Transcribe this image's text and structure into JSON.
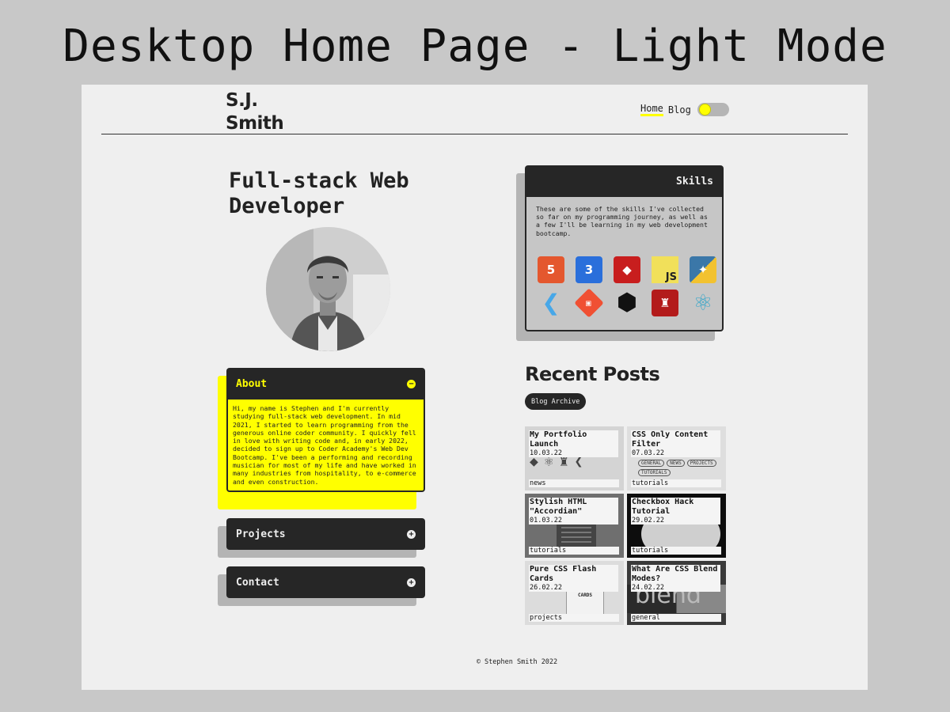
{
  "banner": "Desktop Home Page - Light Mode",
  "header": {
    "logo_line1": "S.J.",
    "logo_line2": "Smith",
    "nav": [
      "Home",
      "Blog"
    ],
    "theme_toggle": "light"
  },
  "hero": {
    "headline": "Full-stack Web Developer"
  },
  "accordion": [
    {
      "label": "About",
      "state": "open",
      "body": "Hi, my name is Stephen and I'm currently studying full-stack web development. In mid 2021, I started to learn programming from the generous online coder community. I quickly fell in love with writing code and, in early 2022, decided to sign up to Coder Academy's Web Dev Bootcamp. I've been a performing and recording musician for most of my life and have worked in many industries from hospitality, to e-commerce and even construction."
    },
    {
      "label": "Projects",
      "state": "closed"
    },
    {
      "label": "Contact",
      "state": "closed"
    }
  ],
  "skills": {
    "title": "Skills",
    "description": "These are some of the skills I've collected so far on my programming journey, as well as a few I'll be learning in my web development bootcamp.",
    "icons": [
      {
        "name": "html5-icon",
        "glyph": "5",
        "color": "#e4572e"
      },
      {
        "name": "css3-icon",
        "glyph": "3",
        "color": "#2a6fdb"
      },
      {
        "name": "ruby-icon",
        "glyph": "◆",
        "color": "#c81e1e"
      },
      {
        "name": "javascript-icon",
        "glyph": "JS",
        "color": "#f1e05a"
      },
      {
        "name": "python-icon",
        "glyph": "✦",
        "color": "#3b77a8"
      },
      {
        "name": "flutter-icon",
        "glyph": "❮",
        "color": "#47a7e8"
      },
      {
        "name": "git-icon",
        "glyph": "◈",
        "color": "#f05033"
      },
      {
        "name": "cube-icon",
        "glyph": "⬢",
        "color": "#222222"
      },
      {
        "name": "rails-icon",
        "glyph": "♜",
        "color": "#b31b1b"
      },
      {
        "name": "react-icon",
        "glyph": "⚛",
        "color": "#61dafb"
      }
    ]
  },
  "recent_posts": {
    "title": "Recent Posts",
    "archive_button": "Blog Archive",
    "posts": [
      {
        "title": "My Portfolio Launch",
        "date": "10.03.22",
        "category": "news",
        "bg": "#d4d4d4"
      },
      {
        "title": "CSS Only Content Filter",
        "date": "07.03.22",
        "category": "tutorials",
        "bg": "#dedede"
      },
      {
        "title": "Stylish HTML \"Accordian\"",
        "date": "01.03.22",
        "category": "tutorials",
        "bg": "#6f6f6f"
      },
      {
        "title": "Checkbox Hack Tutorial",
        "date": "29.02.22",
        "category": "tutorials",
        "bg": "#0d0d0d"
      },
      {
        "title": "Pure CSS Flash Cards",
        "date": "26.02.22",
        "category": "projects",
        "bg": "#dcdcdc"
      },
      {
        "title": "What Are CSS Blend Modes?",
        "date": "24.02.22",
        "category": "general",
        "bg": "#3a3a3a"
      }
    ],
    "filter_art": {
      "heading": "ARCHIVE",
      "chips": [
        "GENERAL",
        "NEWS",
        "PROJECTS",
        "TUTORIALS"
      ]
    },
    "flash_art": "HTTP FLASH CARDS",
    "blend_art": "blend"
  },
  "footer": "© Stephen Smith 2022"
}
